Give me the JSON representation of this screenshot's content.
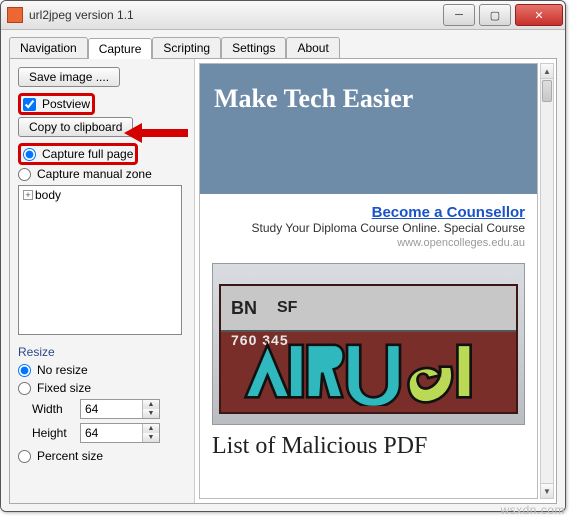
{
  "window": {
    "title": "url2jpeg version 1.1",
    "buttons": {
      "min": "─",
      "max": "▢",
      "close": "✕"
    }
  },
  "tabs": [
    "Navigation",
    "Capture",
    "Scripting",
    "Settings",
    "About"
  ],
  "active_tab": "Capture",
  "sidebar": {
    "save_btn": "Save image ....",
    "postview_chk": "Postview",
    "copy_btn": "Copy to clipboard",
    "capture_full": "Capture full page",
    "capture_manual": "Capture manual zone",
    "tree_root": "body",
    "resize_header": "Resize",
    "no_resize": "No resize",
    "fixed_size": "Fixed size",
    "width_label": "Width",
    "width_value": "64",
    "height_label": "Height",
    "height_value": "64",
    "percent_size": "Percent size"
  },
  "preview": {
    "site_title": "Make Tech Easier",
    "ad_title": "Become a Counsellor",
    "ad_sub": "Study Your Diploma Course Online. Special Course",
    "ad_url": "www.opencolleges.edu.au",
    "rail_bn": "BN",
    "rail_sf": "SF",
    "rail_num": "760 345",
    "next_headline": "List of Malicious PDF"
  },
  "watermark": "wsxdn.com"
}
